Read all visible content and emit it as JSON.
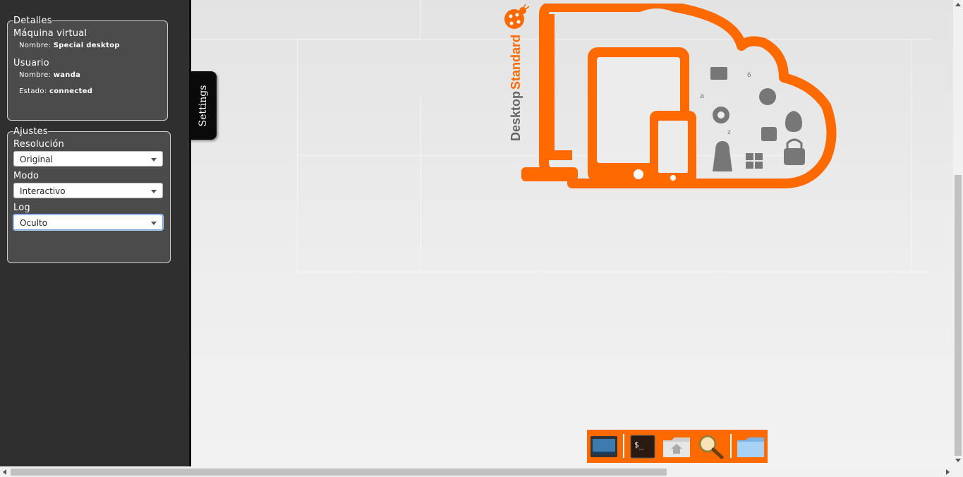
{
  "sidebar": {
    "details": {
      "legend": "Detalles",
      "vm_title": "Máquina virtual",
      "vm_name_label": "Nombre:",
      "vm_name_value": "Special desktop",
      "user_title": "Usuario",
      "user_name_label": "Nombre:",
      "user_name_value": "wanda",
      "status_label": "Estado:",
      "status_value": "connected"
    },
    "settings": {
      "legend": "Ajustes",
      "resolution_label": "Resolución",
      "resolution_value": "Original",
      "mode_label": "Modo",
      "mode_value": "Interactivo",
      "log_label": "Log",
      "log_value": "Oculto"
    }
  },
  "settings_tab": {
    "label": "Settings"
  },
  "logo": {
    "brand_left": "Desktop",
    "brand_right": "Standard",
    "accent_color": "#ff6a00"
  },
  "dock": {
    "items": [
      {
        "name": "show-desktop-icon"
      },
      {
        "name": "terminal-icon"
      },
      {
        "name": "home-folder-icon"
      },
      {
        "name": "search-icon"
      },
      {
        "name": "folder-icon"
      }
    ]
  },
  "colors": {
    "sidebar_bg": "#2f2f2f",
    "panel_bg": "#4b4b4b",
    "accent": "#ff6a00"
  }
}
